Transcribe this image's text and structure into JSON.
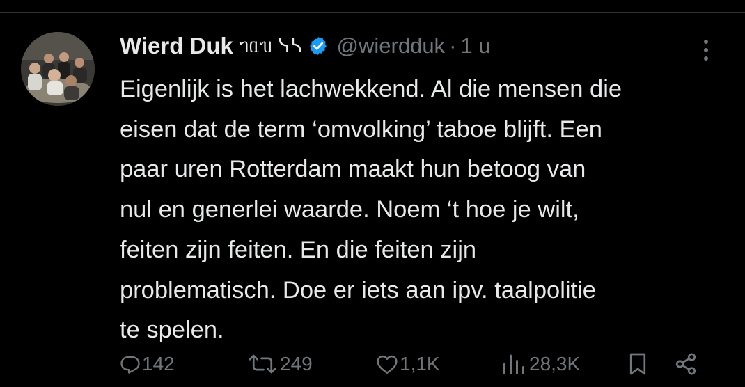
{
  "tweet": {
    "display_name": "Wierd Duk",
    "name_decoration": "ᥐᥲᥔ ᓭᓴ",
    "handle": "@wierdduk",
    "separator": "·",
    "time": "1 u",
    "body_lines": [
      "Eigenlijk is het lachwekkend. Al die mensen die",
      "eisen dat de term ‘omvolking’ taboe blijft. Een",
      "paar uren Rotterdam maakt hun betoog van",
      "nul en generlei waarde. Noem ‘t hoe je wilt,",
      "feiten zijn feiten. En die feiten zijn",
      "problematisch. Doe er iets aan ipv. taalpolitie",
      "te spelen."
    ]
  },
  "actions": {
    "replies": "142",
    "reposts": "249",
    "likes": "1,1K",
    "views": "28,3K"
  },
  "icons": {
    "verified": "verified-badge-icon",
    "more": "more-options-icon",
    "reply": "reply-icon",
    "repost": "repost-icon",
    "like": "heart-icon",
    "views": "views-chart-icon",
    "bookmark": "bookmark-icon",
    "share": "share-icon"
  },
  "colors": {
    "background": "#000000",
    "text": "#e7e9ea",
    "secondary": "#71767b",
    "verified": "#1d9bf0"
  }
}
